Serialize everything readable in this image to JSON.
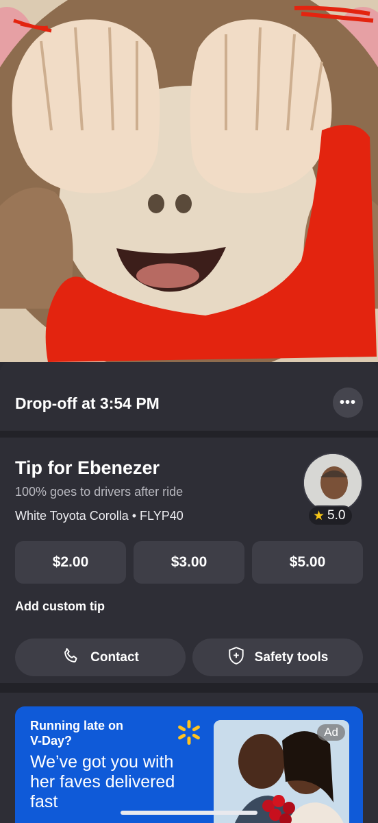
{
  "trip": {
    "dropoff_label": "Drop-off at 3:54 PM"
  },
  "tip": {
    "title": "Tip for Ebenezer",
    "subtitle": "100% goes to drivers after ride",
    "vehicle": "White Toyota Corolla • FLYP40",
    "rating": "5.0",
    "options": [
      "$2.00",
      "$3.00",
      "$5.00"
    ],
    "custom_label": "Add custom tip"
  },
  "actions": {
    "contact": "Contact",
    "safety": "Safety tools"
  },
  "ad": {
    "small_text": "Running late on V-Day?",
    "headline": "We’ve got you with her faves delivered fast",
    "badge": "Ad"
  },
  "colors": {
    "accent_ad": "#0f5ad8",
    "background": "#2e2e36",
    "scribble": "#e3240f"
  },
  "icons": [
    "more-icon",
    "star-icon",
    "phone-icon",
    "shield-icon",
    "walmart-spark-icon"
  ]
}
